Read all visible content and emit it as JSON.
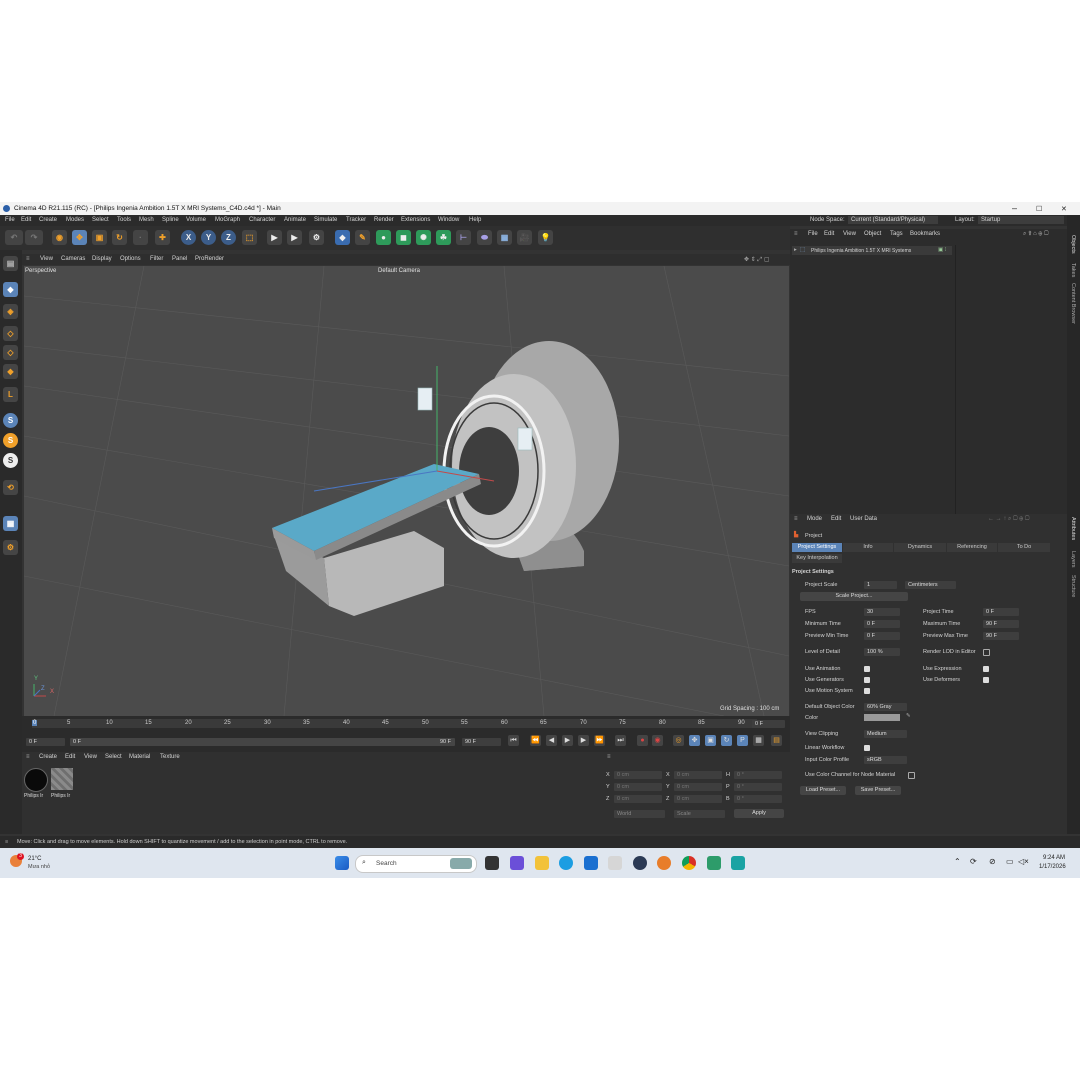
{
  "window": {
    "title": "Cinema 4D R21.115 (RC) - [Philips Ingenia Ambition 1.5T X MRI Systems_C4D.c4d *] - Main",
    "minimize": "–",
    "maximize": "☐",
    "close": "✕"
  },
  "menubar": {
    "items": [
      "File",
      "Edit",
      "Create",
      "Modes",
      "Select",
      "Tools",
      "Mesh",
      "Spline",
      "Volume",
      "MoGraph",
      "Character",
      "Animate",
      "Simulate",
      "Tracker",
      "Render",
      "Extensions",
      "Window",
      "Help"
    ],
    "node_space_label": "Node Space:",
    "node_space_value": "Current (Standard/Physical)",
    "layout_label": "Layout:",
    "layout_value": "Startup"
  },
  "toolbar": {
    "axis_x": "X",
    "axis_y": "Y",
    "axis_z": "Z"
  },
  "viewport": {
    "menu": [
      "View",
      "Cameras",
      "Display",
      "Options",
      "Filter",
      "Panel",
      "ProRender"
    ],
    "projection": "Perspective",
    "camera": "Default Camera",
    "grid_spacing": "Grid Spacing : 100 cm",
    "axis_labels": [
      "Y",
      "Z",
      "X"
    ]
  },
  "timeline": {
    "ticks": [
      "0",
      "5",
      "10",
      "15",
      "20",
      "25",
      "30",
      "35",
      "40",
      "45",
      "50",
      "55",
      "60",
      "65",
      "70",
      "75",
      "80",
      "85",
      "90"
    ],
    "current_frame": "0 F",
    "start_field": "0 F",
    "min_field": "0 F",
    "end_field": "90 F",
    "max_field": "90 F"
  },
  "material_manager": {
    "menu": [
      "Create",
      "Edit",
      "View",
      "Select",
      "Material",
      "Texture"
    ],
    "materials": [
      {
        "name": "Philips Ir",
        "color": "#0a0a0a"
      },
      {
        "name": "Philips Ir",
        "color": "#8a8a8a"
      }
    ]
  },
  "coordinates": {
    "rows": [
      {
        "a": "X",
        "av": "0 cm",
        "b": "X",
        "bv": "0 cm",
        "c": "H",
        "cv": "0 °"
      },
      {
        "a": "Y",
        "av": "0 cm",
        "b": "Y",
        "bv": "0 cm",
        "c": "P",
        "cv": "0 °"
      },
      {
        "a": "Z",
        "av": "0 cm",
        "b": "Z",
        "bv": "0 cm",
        "c": "B",
        "cv": "0 °"
      }
    ],
    "mode": "World",
    "scale_mode": "Scale",
    "apply": "Apply"
  },
  "object_manager": {
    "menu": [
      "File",
      "Edit",
      "View",
      "Object",
      "Tags",
      "Bookmarks"
    ],
    "object_name": "Philips Ingenia Ambition 1.5T X MRI Systems"
  },
  "attribute_manager": {
    "menu": [
      "Mode",
      "Edit",
      "User Data"
    ],
    "header": "Project",
    "tabs": [
      "Project Settings",
      "Info",
      "Dynamics",
      "Referencing",
      "To Do"
    ],
    "tab2": "Key Interpolation",
    "section": "Project Settings",
    "project_scale_label": "Project Scale",
    "project_scale_value": "1",
    "project_scale_unit": "Centimeters",
    "scale_project_btn": "Scale Project...",
    "fps_label": "FPS",
    "fps_value": "30",
    "project_time_label": "Project Time",
    "project_time_value": "0 F",
    "min_time_label": "Minimum Time",
    "min_time_value": "0 F",
    "max_time_label": "Maximum Time",
    "max_time_value": "90 F",
    "prev_min_label": "Preview Min Time",
    "prev_min_value": "0 F",
    "prev_max_label": "Preview Max Time",
    "prev_max_value": "90 F",
    "lod_label": "Level of Detail",
    "lod_value": "100 %",
    "render_lod_label": "Render LOD in Editor",
    "use_animation": "Use Animation",
    "use_expression": "Use Expression",
    "use_generators": "Use Generators",
    "use_deformers": "Use Deformers",
    "use_motion": "Use Motion System",
    "default_obj_color_label": "Default Object Color",
    "default_obj_color_value": "60% Gray",
    "color_label": "Color",
    "view_clipping_label": "View Clipping",
    "view_clipping_value": "Medium",
    "linear_workflow": "Linear Workflow",
    "input_color_profile_label": "Input Color Profile",
    "input_color_profile_value": "sRGB",
    "color_channel_label": "Use Color Channel for Node Material",
    "load_preset": "Load Preset...",
    "save_preset": "Save Preset..."
  },
  "right_rail": [
    "Objects",
    "Takes",
    "Content Browser",
    "Attributes",
    "Layers",
    "Structure"
  ],
  "status": "Move: Click and drag to move elements. Hold down SHIFT to quantize movement / add to the selection in point mode, CTRL to remove.",
  "taskbar": {
    "weather_badge": "3",
    "temperature": "21°C",
    "weather_desc": "Mưa nhỏ",
    "search_placeholder": "Search",
    "time": "9:24 AM",
    "date": "1/17/2026"
  },
  "colors": {
    "accent": "#5b84b8",
    "table_top": "#5aa9c8"
  }
}
